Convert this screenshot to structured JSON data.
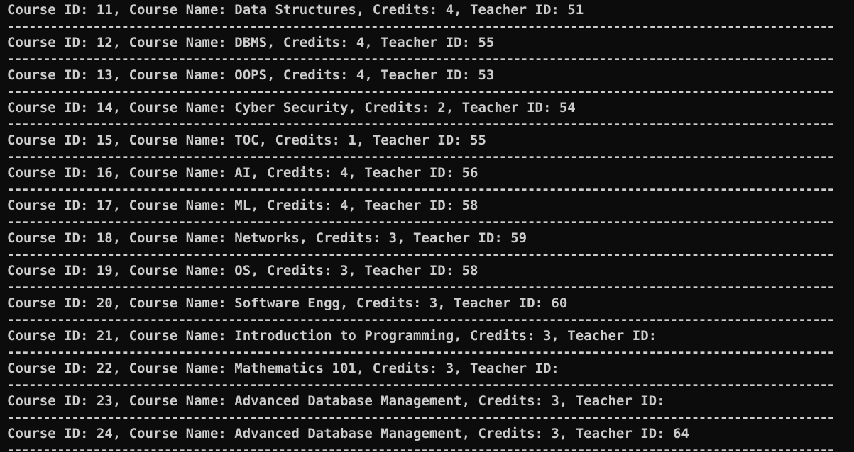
{
  "colors": {
    "background": "#0c0c0c",
    "text": "#cccccc"
  },
  "terminal": {
    "lines": [
      "Course ID: 11, Course Name: Data Structures, Credits: 4, Teacher ID: 51",
      "Course ID: 12, Course Name: DBMS, Credits: 4, Teacher ID: 55",
      "Course ID: 13, Course Name: OOPS, Credits: 4, Teacher ID: 53",
      "Course ID: 14, Course Name: Cyber Security, Credits: 2, Teacher ID: 54",
      "Course ID: 15, Course Name: TOC, Credits: 1, Teacher ID: 55",
      "Course ID: 16, Course Name: AI, Credits: 4, Teacher ID: 56",
      "Course ID: 17, Course Name: ML, Credits: 4, Teacher ID: 58",
      "Course ID: 18, Course Name: Networks, Credits: 3, Teacher ID: 59",
      "Course ID: 19, Course Name: OS, Credits: 3, Teacher ID: 58",
      "Course ID: 20, Course Name: Software Engg, Credits: 3, Teacher ID: 60",
      "Course ID: 21, Course Name: Introduction to Programming, Credits: 3, Teacher ID:",
      "Course ID: 22, Course Name: Mathematics 101, Credits: 3, Teacher ID:",
      "Course ID: 23, Course Name: Advanced Database Management, Credits: 3, Teacher ID:",
      "Course ID: 24, Course Name: Advanced Database Management, Credits: 3, Teacher ID: 64"
    ],
    "separator": "--------------------------------------------------------------------------------------------------------------------------------------------------------------------"
  }
}
